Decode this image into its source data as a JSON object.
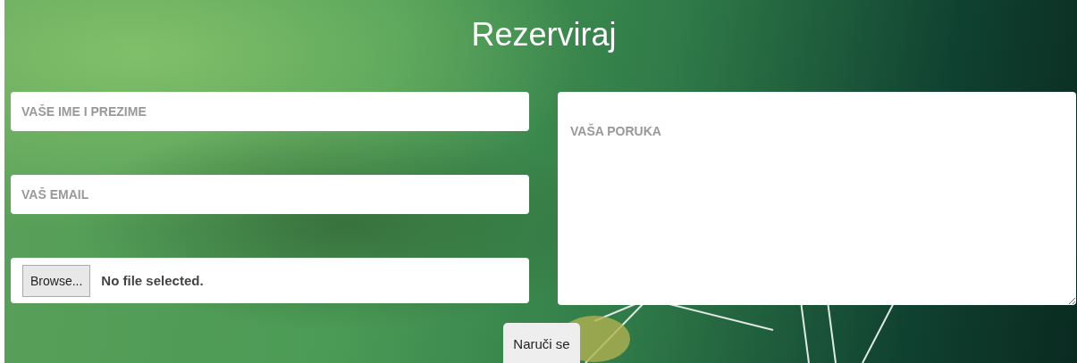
{
  "title": "Rezerviraj",
  "name_field": {
    "placeholder": "VAŠE IME I PREZIME"
  },
  "email_field": {
    "placeholder": "VAŠ EMAIL"
  },
  "file_field": {
    "button": "Browse...",
    "status": "No file selected."
  },
  "message_field": {
    "placeholder": "VAŠA PORUKA"
  },
  "submit_button": {
    "label": "Naruči se"
  }
}
